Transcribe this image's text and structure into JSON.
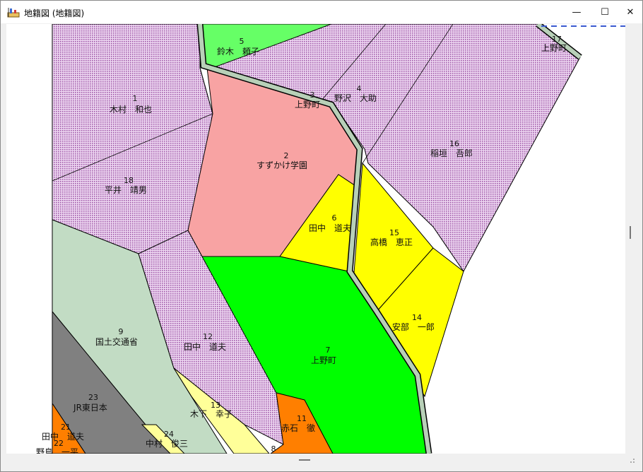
{
  "window": {
    "title": "地籍図 (地籍図)",
    "icon": "cadastral-map-app-icon",
    "controls": {
      "minimize": "—",
      "maximize": "☐",
      "close": "✕"
    }
  },
  "parcels": [
    {
      "no": "1",
      "owner": "木村　和也"
    },
    {
      "no": "2",
      "owner": "すずかけ学園"
    },
    {
      "no": "3",
      "owner": "上野町"
    },
    {
      "no": "4",
      "owner": "野沢　大助"
    },
    {
      "no": "5",
      "owner": "鈴木　頼子"
    },
    {
      "no": "6",
      "owner": "田中　道夫"
    },
    {
      "no": "7",
      "owner": "上野町"
    },
    {
      "no": "8",
      "owner": ""
    },
    {
      "no": "9",
      "owner": "国土交通省"
    },
    {
      "no": "11",
      "owner": "赤石　徹"
    },
    {
      "no": "12",
      "owner": "田中　道夫"
    },
    {
      "no": "13",
      "owner": "木下　幸子"
    },
    {
      "no": "14",
      "owner": "安部　一郎"
    },
    {
      "no": "15",
      "owner": "高橋　恵正"
    },
    {
      "no": "16",
      "owner": "稲垣　吾郎"
    },
    {
      "no": "17",
      "owner": "上野町"
    },
    {
      "no": "18",
      "owner": "平井　靖男"
    },
    {
      "no": "21",
      "owner": "田中　道夫"
    },
    {
      "no": "22",
      "owner": "野島　一平"
    },
    {
      "no": "23",
      "owner": "JR東日本"
    },
    {
      "no": "24",
      "owner": "中村　俊三"
    }
  ],
  "colors": {
    "residential": "#dcaee4",
    "school": "#f8a3a3",
    "yellow": "#ffff00",
    "green": "#00ff00",
    "light_green": "#66ff66",
    "road": "#b8d0b8",
    "government": "#c2dcc4",
    "railway": "#808080",
    "orange": "#ff7f00",
    "pale_yellow": "#ffff99"
  }
}
